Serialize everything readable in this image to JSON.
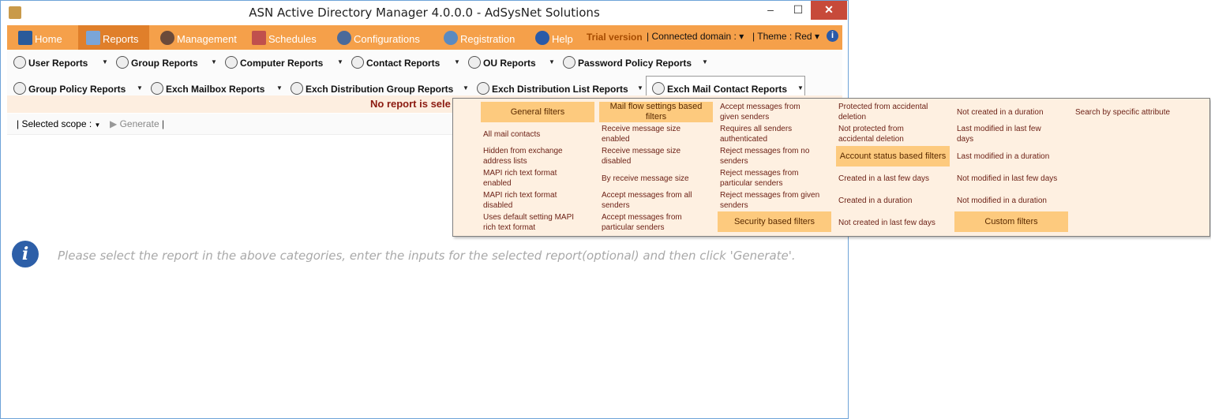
{
  "window": {
    "title": "ASN Active Directory Manager 4.0.0.0 - AdSysNet Solutions",
    "controls": [
      "–",
      "☐",
      "✕"
    ]
  },
  "menu": {
    "tabs": [
      {
        "label": "Home",
        "icon": "home-icon"
      },
      {
        "label": "Reports",
        "icon": "reports-icon"
      },
      {
        "label": "Management",
        "icon": "management-icon"
      },
      {
        "label": "Schedules",
        "icon": "schedules-icon"
      },
      {
        "label": "Configurations",
        "icon": "configurations-icon"
      },
      {
        "label": "Registration",
        "icon": "registration-icon"
      },
      {
        "label": "Help",
        "icon": "help-icon"
      }
    ],
    "trial": "Trial version",
    "connected": "Connected domain :",
    "theme": "Theme : Red"
  },
  "reports": {
    "row1": [
      "User Reports",
      "Group Reports",
      "Computer Reports",
      "Contact Reports",
      "OU Reports",
      "Password Policy Reports"
    ],
    "row2": [
      "Group Policy Reports",
      "Exch Mailbox Reports",
      "Exch Distribution Group Reports",
      "Exch Distribution List Reports",
      "Exch Mail Contact Reports"
    ]
  },
  "band": {
    "text": "No report is sele"
  },
  "scope": {
    "label": "Selected scope :",
    "generate": "Generate"
  },
  "message": "Please select the report in the above categories, enter the inputs for the selected report(optional) and then click 'Generate'.",
  "dropdown": {
    "col1": {
      "header": "General filters",
      "items": [
        "All mail contacts",
        "Hidden from exchange address lists",
        "MAPI rich text format enabled",
        "MAPI rich text format disabled",
        "Uses default setting MAPI rich text format"
      ]
    },
    "col2": {
      "header": "Mail flow settings based filters",
      "items": [
        "Receive message size enabled",
        "Receive message size disabled",
        "By receive message size",
        "Accept messages from all senders",
        "Accept messages from particular senders"
      ]
    },
    "col3": {
      "items": [
        "Accept messages from given senders",
        "Requires all senders authenticated",
        "Reject messages from no senders",
        "Reject messages from particular senders",
        "Reject messages from given senders"
      ],
      "header": "Security based filters"
    },
    "col4": {
      "items_top": [
        "Protected from accidental deletion",
        "Not protected from accidental deletion"
      ],
      "header": "Account status based filters",
      "items_bottom": [
        "Created in a last few days",
        "Created in a duration",
        "Not created in last few days"
      ]
    },
    "col5": {
      "items": [
        "Not created in a duration",
        "Last modified in last few days",
        "Last modified in a duration",
        "Not modified in last few days",
        "Not modified in a duration"
      ],
      "header": "Custom filters"
    },
    "col6": {
      "items": [
        "Search by specific attribute"
      ]
    }
  }
}
